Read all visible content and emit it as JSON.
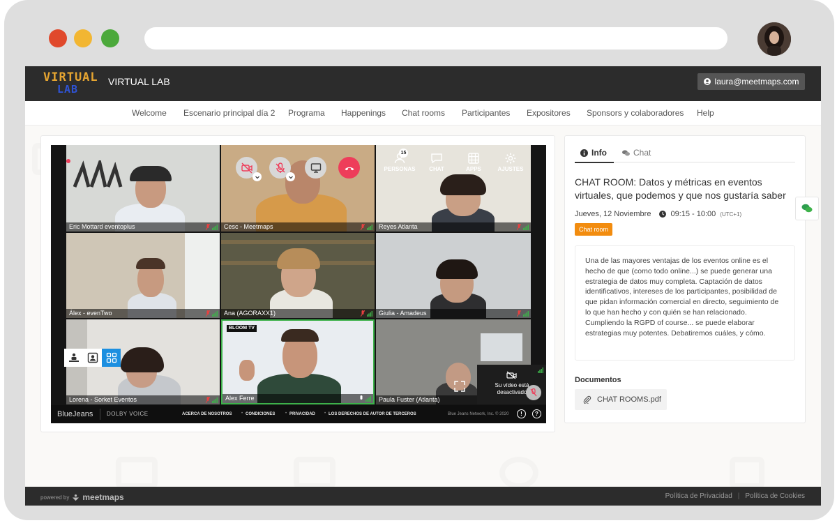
{
  "app": {
    "logo_line1": "VIRTUAL",
    "logo_line2": "LAB",
    "brand_name": "VIRTUAL LAB",
    "user_email": "laura@meetmaps.com"
  },
  "nav": {
    "items": [
      "Welcome",
      "Escenario principal día 2",
      "Programa",
      "Happenings",
      "Chat rooms",
      "Participantes",
      "Expositores",
      "Sponsors y colaboradores",
      "Help"
    ]
  },
  "video": {
    "participants": [
      "Eric Mottard eventoplus",
      "Cesc - Meetmaps",
      "Reyes Atlanta",
      "Álex - evenTwo",
      "Ana (AGORAXX1)",
      "Giulia - Amadeus",
      "Lorena - Sorket Eventos",
      "Alex Ferre",
      "Paula Fuster (Atlanta)"
    ],
    "people_count": "15",
    "top_actions": [
      "PERSONAS",
      "CHAT",
      "APPS",
      "AJUSTES"
    ],
    "bloom_logo": "BLOOM TV",
    "self_view_text": "Su vídeo está desactivado",
    "bottom_brand": "BlueJeans",
    "dolby": "DOLBY VOICE",
    "bottom_links": [
      "ACERCA DE NOSOTROS",
      "CONDICIONES",
      "PRIVACIDAD",
      "LOS DERECHOS DE AUTOR DE TERCEROS"
    ],
    "copyright": "Blue Jeans Network, Inc. © 2020",
    "info_glyph": "!",
    "help_glyph": "?"
  },
  "info_panel": {
    "tab_info": "Info",
    "tab_chat": "Chat",
    "title": "CHAT ROOM: Datos y métricas en eventos virtuales, que podemos y que nos gustaría saber",
    "date": "Jueves, 12 Noviembre",
    "time": "09:15 - 10:00",
    "timezone": "(UTC+1)",
    "tag": "Chat room",
    "description": "Una de las mayores ventajas de los eventos online es el hecho de que (como todo online...) se puede generar una estrategia de datos muy completa. Captación de datos identificativos, intereses de los participantes, posibilidad de que pidan información comercial en directo, seguimiento de lo que han hecho y con quién se han relacionado. Cumpliendo la RGPD of course... se puede elaborar estrategias muy potentes. Debatiremos cuáles, y cómo.",
    "documents_label": "Documentos",
    "document_name": "CHAT ROOMS.pdf"
  },
  "footer": {
    "powered_by": "powered by",
    "meetmaps": "meetmaps",
    "privacy": "Política de Privacidad",
    "cookies": "Política de Cookies"
  },
  "colors": {
    "accent_orange": "#f28c0f",
    "active_speaker": "#3db24a",
    "hangup_red": "#ee3d5a",
    "layout_blue": "#1c8fe0"
  }
}
